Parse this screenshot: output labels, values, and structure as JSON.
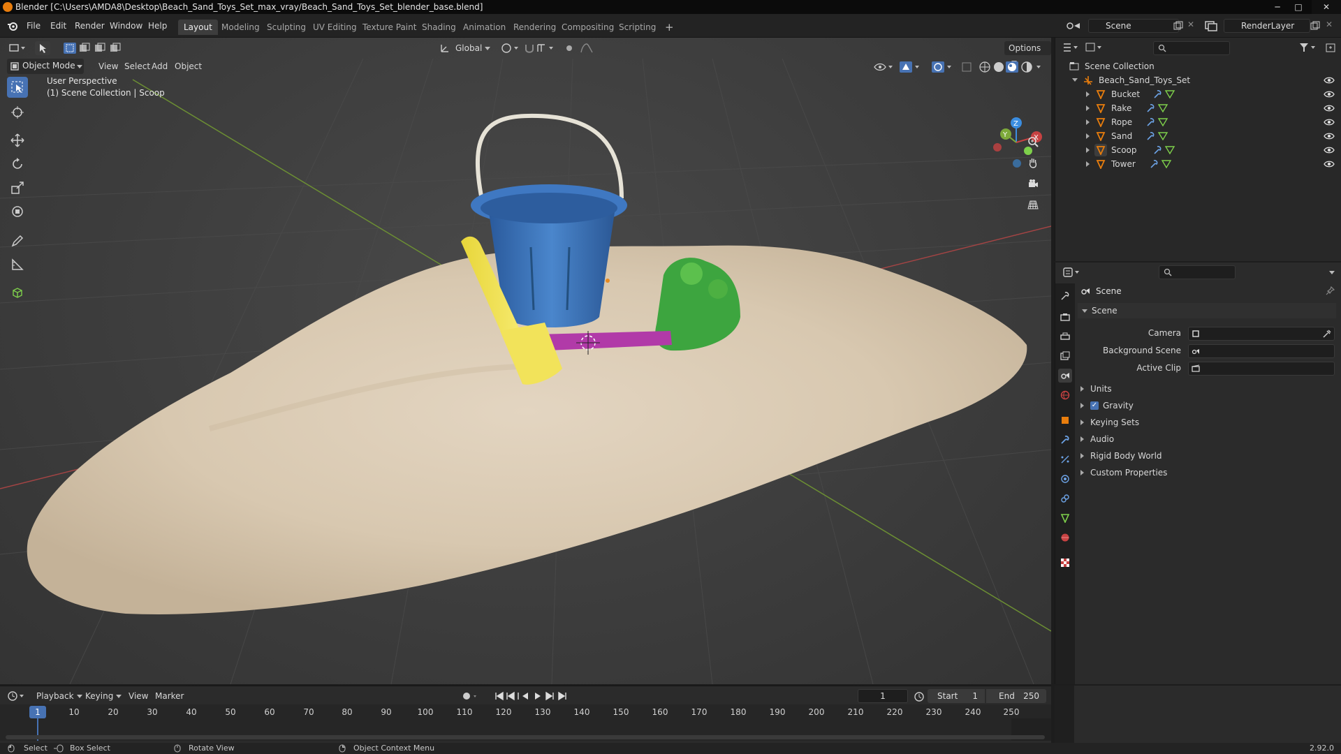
{
  "window": {
    "title": "Blender [C:\\Users\\AMDA8\\Desktop\\Beach_Sand_Toys_Set_max_vray/Beach_Sand_Toys_Set_blender_base.blend]",
    "minimize": "─",
    "maximize": "□",
    "close": "✕"
  },
  "menus": [
    "File",
    "Edit",
    "Render",
    "Window",
    "Help"
  ],
  "workspaces": [
    "Layout",
    "Modeling",
    "Sculpting",
    "UV Editing",
    "Texture Paint",
    "Shading",
    "Animation",
    "Rendering",
    "Compositing",
    "Scripting"
  ],
  "active_workspace": 0,
  "add_workspace": "+",
  "scene_selector": "Scene",
  "view_layer_selector": "RenderLayer",
  "viewport": {
    "mode": "Object Mode",
    "menus": [
      "View",
      "Select",
      "Add",
      "Object"
    ],
    "transform_orientation": "Global",
    "options_label": "Options",
    "overlay_text_1": "User Perspective",
    "overlay_text_2": "(1) Scene Collection | Scoop",
    "gizmo": {
      "x": "X",
      "y": "Y",
      "z": "Z"
    }
  },
  "outliner": {
    "root": "Scene Collection",
    "collection": "Beach_Sand_Toys_Set",
    "objects": [
      "Bucket",
      "Rake",
      "Rope",
      "Sand",
      "Scoop",
      "Tower"
    ]
  },
  "properties": {
    "header": "Scene",
    "panel_title": "Scene",
    "fields": [
      {
        "label": "Camera",
        "value": ""
      },
      {
        "label": "Background Scene",
        "value": ""
      },
      {
        "label": "Active Clip",
        "value": ""
      }
    ],
    "panels": [
      {
        "label": "Units",
        "checkbox": false
      },
      {
        "label": "Gravity",
        "checkbox": true
      },
      {
        "label": "Keying Sets",
        "checkbox": false
      },
      {
        "label": "Audio",
        "checkbox": false
      },
      {
        "label": "Rigid Body World",
        "checkbox": false
      },
      {
        "label": "Custom Properties",
        "checkbox": false
      }
    ]
  },
  "timeline": {
    "menus": [
      "Playback",
      "Keying",
      "View",
      "Marker"
    ],
    "current_frame": "1",
    "start_label": "Start",
    "start_value": "1",
    "end_label": "End",
    "end_value": "250",
    "ruler": [
      "1",
      "10",
      "20",
      "30",
      "40",
      "50",
      "60",
      "70",
      "80",
      "90",
      "100",
      "110",
      "120",
      "130",
      "140",
      "150",
      "160",
      "170",
      "180",
      "190",
      "200",
      "210",
      "220",
      "230",
      "240",
      "250"
    ]
  },
  "statusbar": {
    "select": "Select",
    "box_select": "Box Select",
    "rotate_view": "Rotate View",
    "context_menu": "Object Context Menu",
    "version": "2.92.0"
  },
  "colors": {
    "accent": "#4772b3",
    "orange": "#e87d0d",
    "mesh_green": "#7ed04b",
    "axis_red": "#c74242",
    "axis_green": "#7da93a",
    "axis_blue": "#3b8de0"
  }
}
